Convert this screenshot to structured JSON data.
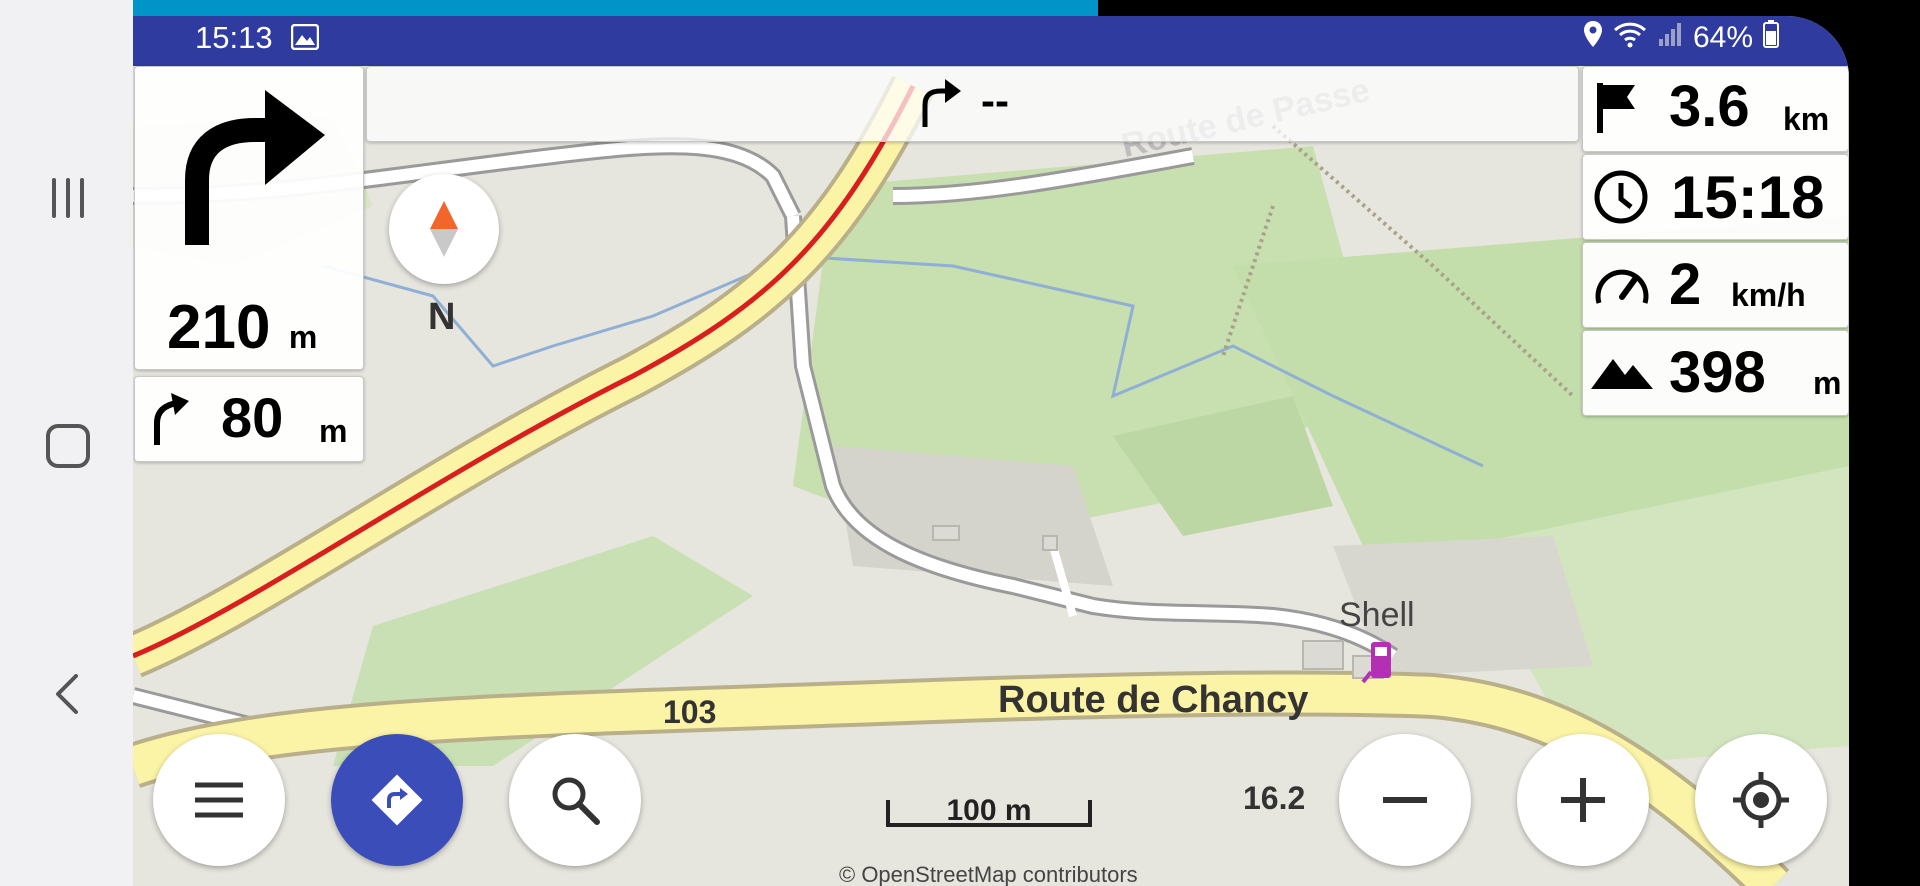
{
  "system_nav": {
    "recents_icon": "recents-icon",
    "home_icon": "home-icon",
    "back_icon": "back-icon"
  },
  "status_bar": {
    "time": "15:13",
    "battery": "64%",
    "icons": [
      "image-icon",
      "location-icon",
      "wifi-icon",
      "signal-icon",
      "battery-icon"
    ]
  },
  "navigation": {
    "next_turn_distance": "210",
    "next_turn_unit": "m",
    "then_turn_distance": "80",
    "then_turn_unit": "m",
    "street_banner": "--",
    "compass_label": "N"
  },
  "widgets": {
    "distance": {
      "value": "3.6",
      "unit": "km"
    },
    "arrival_time": {
      "value": "15:18"
    },
    "speed": {
      "value": "2",
      "unit": "km/h"
    },
    "altitude": {
      "value": "398",
      "unit": "m"
    }
  },
  "map": {
    "road_103": "103",
    "road_name_main": "Route de Chancy",
    "road_name_top": "Route de Passe",
    "poi_shell": "Shell",
    "zoom_level": "16.2",
    "scale_label": "100 m",
    "attribution": "© OpenStreetMap contributors",
    "route_color": "#d81e1e",
    "primary_road_color": "#fbf3a6"
  },
  "buttons": {
    "menu": "menu-icon",
    "navigation": "directions-icon",
    "search": "search-icon",
    "zoom_out": "minus-icon",
    "zoom_in": "plus-icon",
    "my_location": "my-location-icon"
  }
}
